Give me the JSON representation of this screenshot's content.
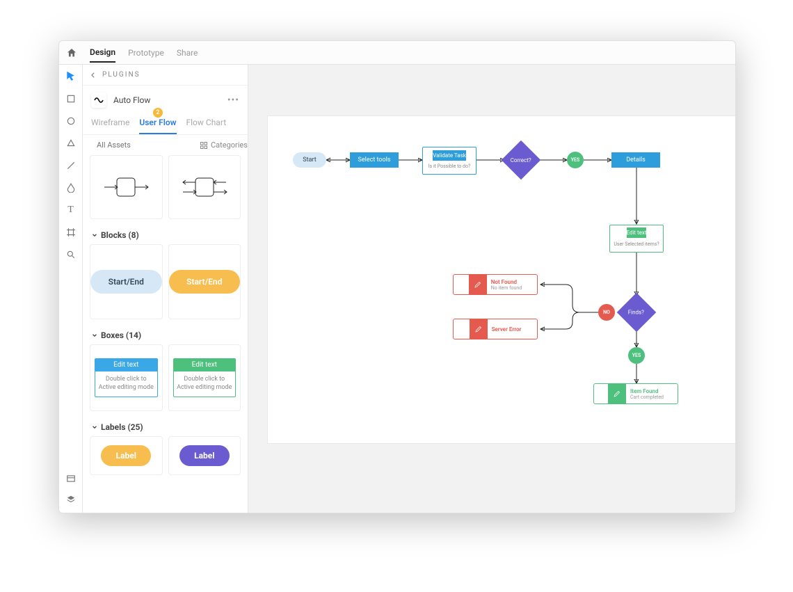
{
  "menubar": {
    "items": [
      "Design",
      "Prototype",
      "Share"
    ],
    "active": "Design"
  },
  "sidepanel": {
    "crumb_label": "PLUGINS",
    "plugin_name": "Auto Flow",
    "tabs": {
      "wireframe": "Wireframe",
      "userflow": "User Flow",
      "flowchart": "Flow Chart",
      "badge": "2"
    },
    "search_placeholder": "All Assets",
    "categories_label": "Categories",
    "sections": {
      "blocks": {
        "title": "Blocks (8)",
        "pill_text": "Start/End"
      },
      "boxes": {
        "title": "Boxes (14)",
        "header_text": "Edit text",
        "body_text": "Double click to Active editing mode"
      },
      "labels": {
        "title": "Labels (25)",
        "label_text": "Label"
      }
    }
  },
  "flow": {
    "start": "Start",
    "select_tools": "Select tools",
    "validate": {
      "title": "Validate Task",
      "sub": "Is it Possible to do?"
    },
    "correct": "Correct?",
    "yes": "YES",
    "no": "NO",
    "details": "Details",
    "edit": {
      "title": "Edit text",
      "sub": "User Selected items?"
    },
    "finds": "Finds?",
    "notfound": {
      "title": "Not Found",
      "sub": "No item found"
    },
    "servererror": {
      "title": "Server Error",
      "sub": ""
    },
    "itemfound": {
      "title": "Item Found",
      "sub": "Cart completed"
    }
  }
}
